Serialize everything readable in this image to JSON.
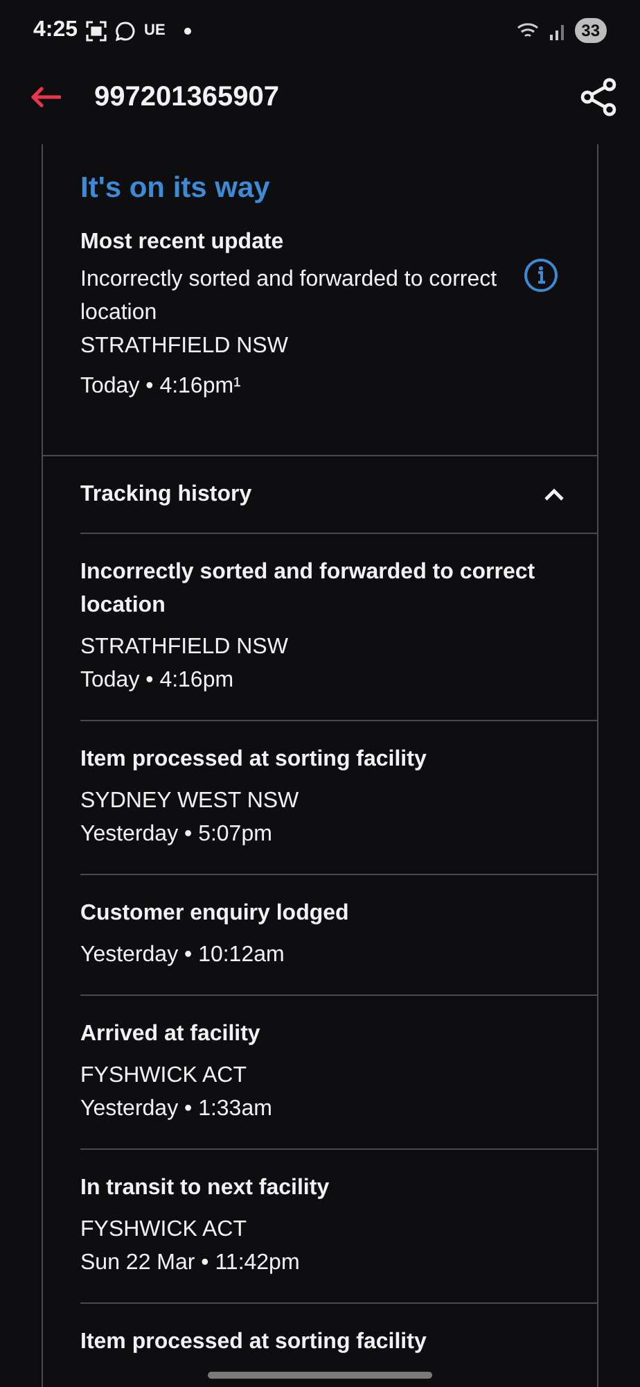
{
  "status_bar": {
    "time": "4:25",
    "carrier": "UE",
    "battery": "33"
  },
  "header": {
    "title": "997201365907"
  },
  "summary": {
    "status": "It's on its way",
    "heading": "Most recent update",
    "description": "Incorrectly sorted and forwarded to correct location",
    "location": "STRATHFIELD NSW",
    "time": "Today • 4:16pm¹"
  },
  "history": {
    "title": "Tracking history",
    "expanded": true,
    "events": [
      {
        "description": "Incorrectly sorted and forwarded to correct location",
        "location": "STRATHFIELD NSW",
        "time": "Today • 4:16pm"
      },
      {
        "description": "Item processed at sorting facility",
        "location": "SYDNEY WEST NSW",
        "time": "Yesterday • 5:07pm"
      },
      {
        "description": "Customer enquiry lodged",
        "time": "Yesterday • 10:12am"
      },
      {
        "description": "Arrived at facility",
        "location": "FYSHWICK ACT",
        "time": "Yesterday • 1:33am"
      },
      {
        "description": "In transit to next facility",
        "location": "FYSHWICK ACT",
        "time": "Sun 22 Mar • 11:42pm"
      },
      {
        "description": "Item processed at sorting facility"
      }
    ]
  }
}
